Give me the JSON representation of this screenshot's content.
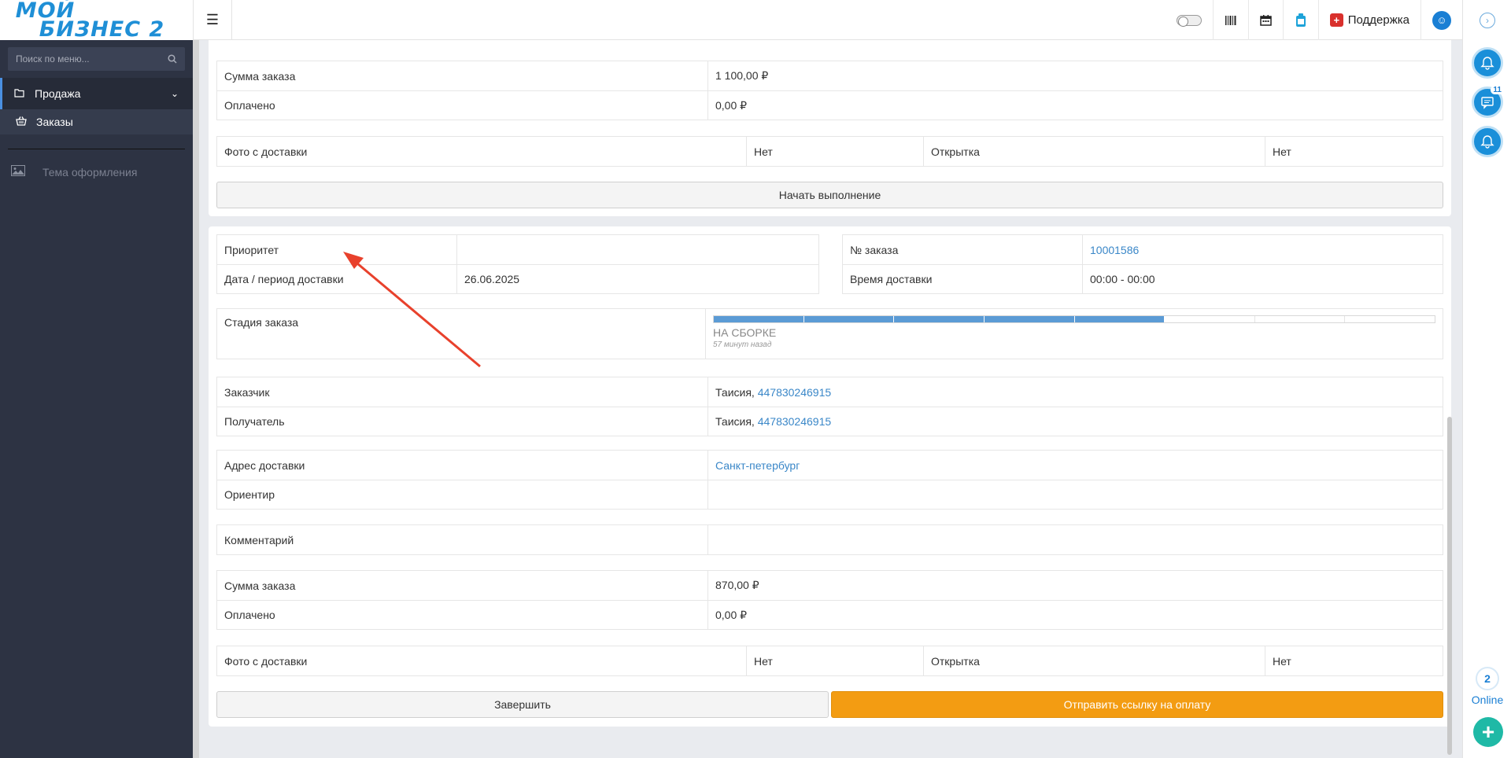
{
  "topbar": {
    "logo_line1": "МОЙ",
    "logo_line2": "БИЗНЕС 2",
    "support_label": "Поддержка",
    "icons": [
      "menu-icon",
      "toggle-switch",
      "barcode-icon",
      "calendar-icon",
      "app-icon",
      "support-icon",
      "user-icon"
    ]
  },
  "sidebar": {
    "search_placeholder": "Поиск по меню...",
    "items": [
      {
        "label": "Продажа",
        "icon": "folder-icon",
        "active": true
      },
      {
        "label": "Заказы",
        "icon": "basket-icon"
      },
      {
        "label": "Тема оформления",
        "icon": "image-icon"
      }
    ]
  },
  "order1": {
    "sum_label": "Сумма заказа",
    "sum_value": "1 100,00 ₽",
    "paid_label": "Оплачено",
    "paid_value": "0,00 ₽",
    "photo_label": "Фото с доставки",
    "photo_value": "Нет",
    "card_label": "Открытка",
    "card_value": "Нет",
    "start_button": "Начать выполнение"
  },
  "order2": {
    "priority_label": "Приоритет",
    "priority_value": "",
    "date_label": "Дата / период доставки",
    "date_value": "26.06.2025",
    "number_label": "№ заказа",
    "number_value": "10001586",
    "time_label": "Время доставки",
    "time_value": "00:00 - 00:00",
    "stage_label": "Стадия заказа",
    "stage_name": "НА СБОРКЕ",
    "stage_time": "57 минут назад",
    "stage_progress": {
      "done": 5,
      "total": 8
    },
    "customer_label": "Заказчик",
    "customer_name": "Таисия,",
    "customer_phone": "447830246915",
    "recipient_label": "Получатель",
    "recipient_name": "Таисия,",
    "recipient_phone": "447830246915",
    "address_label": "Адрес доставки",
    "address_value": "Санкт-петербург",
    "landmark_label": "Ориентир",
    "landmark_value": "",
    "comment_label": "Комментарий",
    "comment_value": "",
    "sum_label": "Сумма заказа",
    "sum_value": "870,00 ₽",
    "paid_label": "Оплачено",
    "paid_value": "0,00 ₽",
    "photo_label": "Фото с доставки",
    "photo_value": "Нет",
    "card_label": "Открытка",
    "card_value": "Нет",
    "finish_button": "Завершить",
    "payment_button": "Отправить ссылку на оплату"
  },
  "right_panel": {
    "chat_badge": "11",
    "online_count": "2",
    "online_label": "Online"
  },
  "colors": {
    "accent": "#3a87c8",
    "sidebar_bg": "#2d3343",
    "orange": "#f39c12",
    "progress": "#5b9bd5",
    "annotation_arrow": "#e8412c"
  }
}
